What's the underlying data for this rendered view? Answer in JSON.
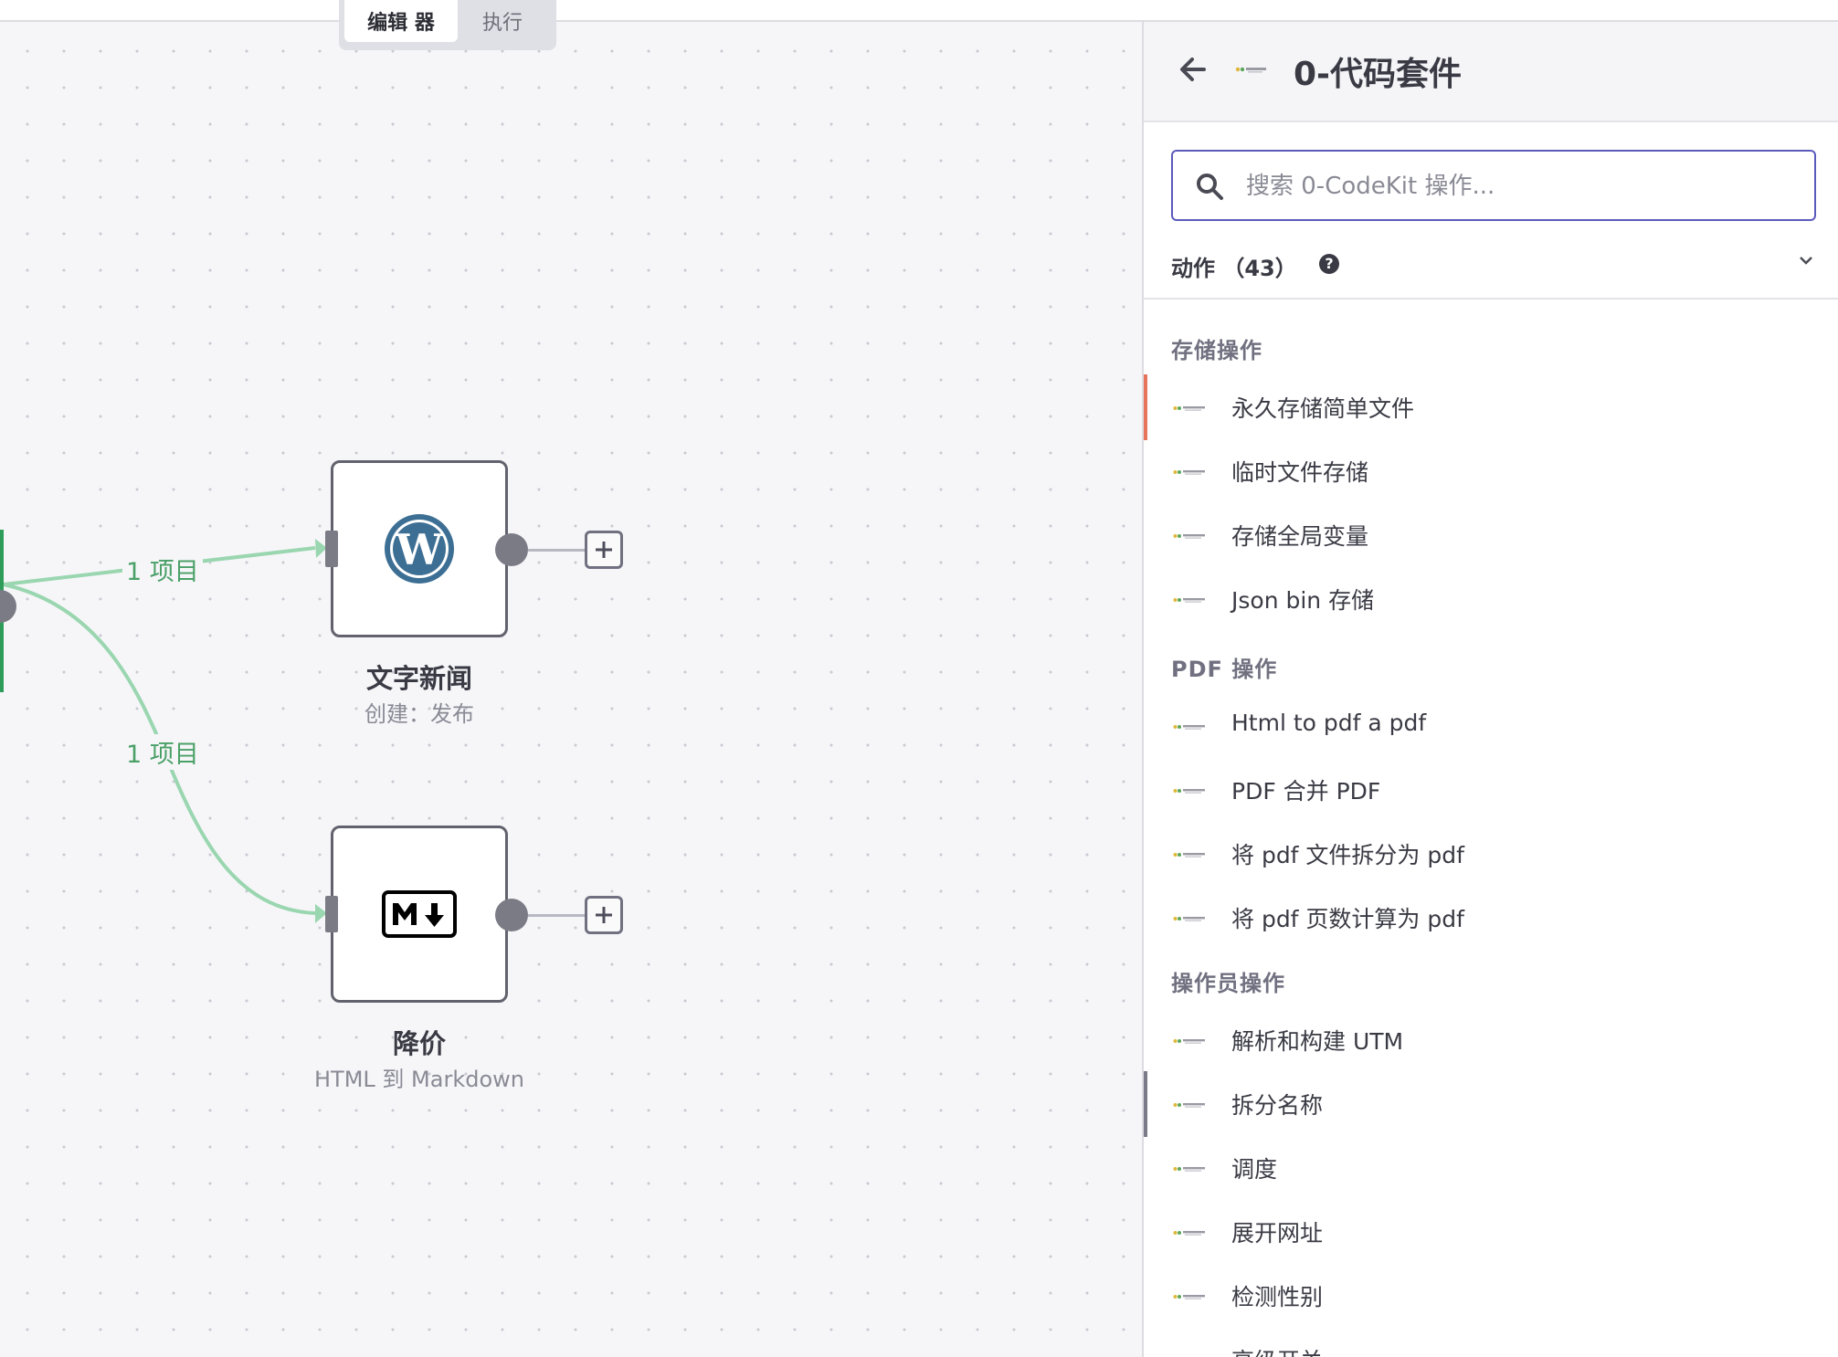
{
  "mode_switch": {
    "editor": "编辑 器",
    "executions": "执行"
  },
  "canvas": {
    "edges": [
      {
        "label": "1 项目"
      },
      {
        "label": "1 项目"
      }
    ],
    "nodes": [
      {
        "title": "文字新闻",
        "subtitle": "创建：发布",
        "icon": "wordpress-icon"
      },
      {
        "title": "降价",
        "subtitle": "HTML 到 Markdown",
        "icon": "markdown-icon"
      }
    ],
    "colors": {
      "edge": "#9ad6b0",
      "edge_label": "#4aa067",
      "node_border": "#62626e"
    }
  },
  "panel": {
    "title": "0-代码套件",
    "search_placeholder": "搜索 0-CodeKit 操作...",
    "actions_label": "动作 （43）",
    "help_icon_text": "?",
    "sections": [
      {
        "title": "存储操作",
        "items": [
          "永久存储简单文件",
          "临时文件存储",
          "存储全局变量",
          "Json bin 存储"
        ]
      },
      {
        "title": "PDF 操作",
        "items": [
          "Html to pdf a pdf",
          "PDF 合并 PDF",
          "将 pdf 文件拆分为 pdf",
          "将 pdf 页数计算为 pdf"
        ]
      },
      {
        "title": "操作员操作",
        "items": [
          "解析和构建 UTM",
          "拆分名称",
          "调度",
          "展开网址",
          "检测性别",
          "高级开关"
        ]
      }
    ],
    "colors": {
      "search_border": "#5b5bbd",
      "active_marker": "#e6735c",
      "hover_marker": "#7a7a88"
    }
  }
}
